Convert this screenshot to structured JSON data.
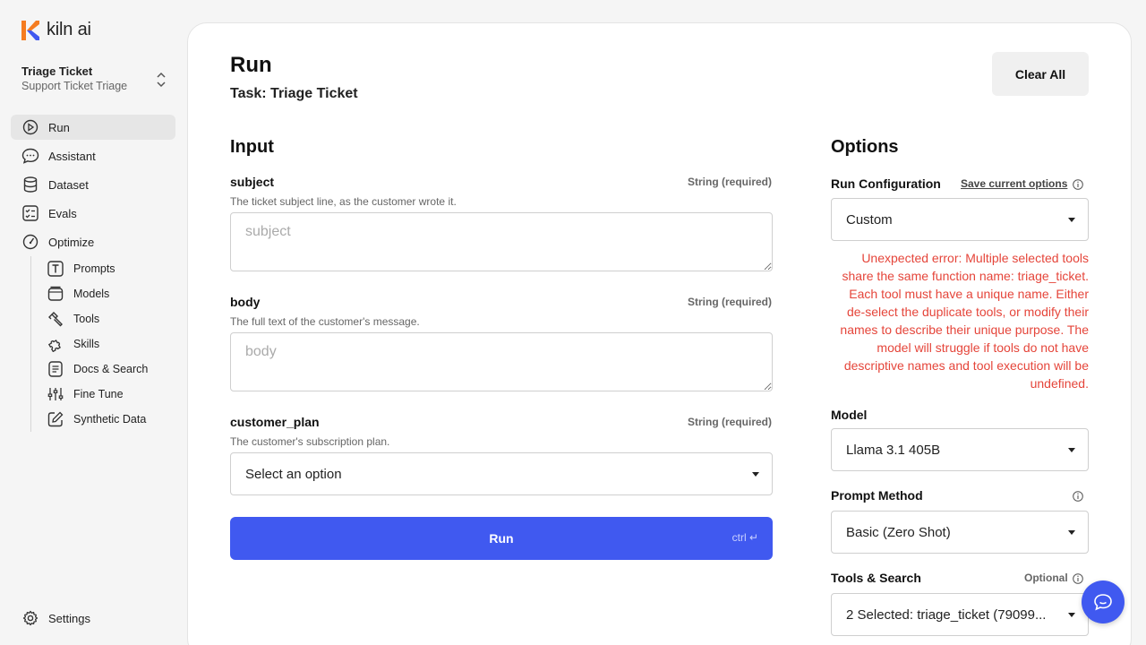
{
  "app": {
    "name": "kiln ai",
    "brand_colors": {
      "orange": "#f57c20",
      "blue": "#4059f0"
    }
  },
  "project": {
    "title": "Triage Ticket",
    "subtitle": "Support Ticket Triage"
  },
  "nav": {
    "items": [
      {
        "label": "Run",
        "icon": "play-circle-icon",
        "active": true
      },
      {
        "label": "Assistant",
        "icon": "chat-bubble-icon"
      },
      {
        "label": "Dataset",
        "icon": "database-icon"
      },
      {
        "label": "Evals",
        "icon": "checklist-icon"
      },
      {
        "label": "Optimize",
        "icon": "gauge-icon"
      }
    ],
    "optimize_sub": [
      {
        "label": "Prompts",
        "icon": "text-box-icon"
      },
      {
        "label": "Models",
        "icon": "models-icon"
      },
      {
        "label": "Tools",
        "icon": "hammer-icon"
      },
      {
        "label": "Skills",
        "icon": "puzzle-icon"
      },
      {
        "label": "Docs & Search",
        "icon": "document-icon"
      },
      {
        "label": "Fine Tune",
        "icon": "sliders-icon"
      },
      {
        "label": "Synthetic Data",
        "icon": "pencil-box-icon"
      }
    ],
    "settings": {
      "label": "Settings",
      "icon": "gear-icon"
    }
  },
  "page": {
    "title": "Run",
    "subtitle": "Task: Triage Ticket",
    "clear_label": "Clear All"
  },
  "input": {
    "heading": "Input",
    "fields": [
      {
        "name": "subject",
        "type": "String (required)",
        "description": "The ticket subject line, as the customer wrote it.",
        "placeholder": "subject",
        "value": ""
      },
      {
        "name": "body",
        "type": "String (required)",
        "description": "The full text of the customer's message.",
        "placeholder": "body",
        "value": ""
      },
      {
        "name": "customer_plan",
        "type": "String (required)",
        "description": "The customer's subscription plan.",
        "selected": "Select an option"
      }
    ],
    "run_label": "Run",
    "run_hint": "ctrl ↵"
  },
  "options": {
    "heading": "Options",
    "run_config": {
      "label": "Run Configuration",
      "save_link": "Save current options",
      "selected": "Custom"
    },
    "error": "Unexpected error: Multiple selected tools share the same function name: triage_ticket. Each tool must have a unique name. Either de-select the duplicate tools, or modify their names to describe their unique purpose. The model will struggle if tools do not have descriptive names and tool execution will be undefined.",
    "model": {
      "label": "Model",
      "selected": "Llama 3.1 405B"
    },
    "prompt_method": {
      "label": "Prompt Method",
      "selected": "Basic (Zero Shot)"
    },
    "tools": {
      "label": "Tools & Search",
      "optional": "Optional",
      "selected": "2 Selected: triage_ticket (79099..."
    }
  },
  "colors": {
    "error": "#e5453a",
    "accent": "#4059f0"
  }
}
